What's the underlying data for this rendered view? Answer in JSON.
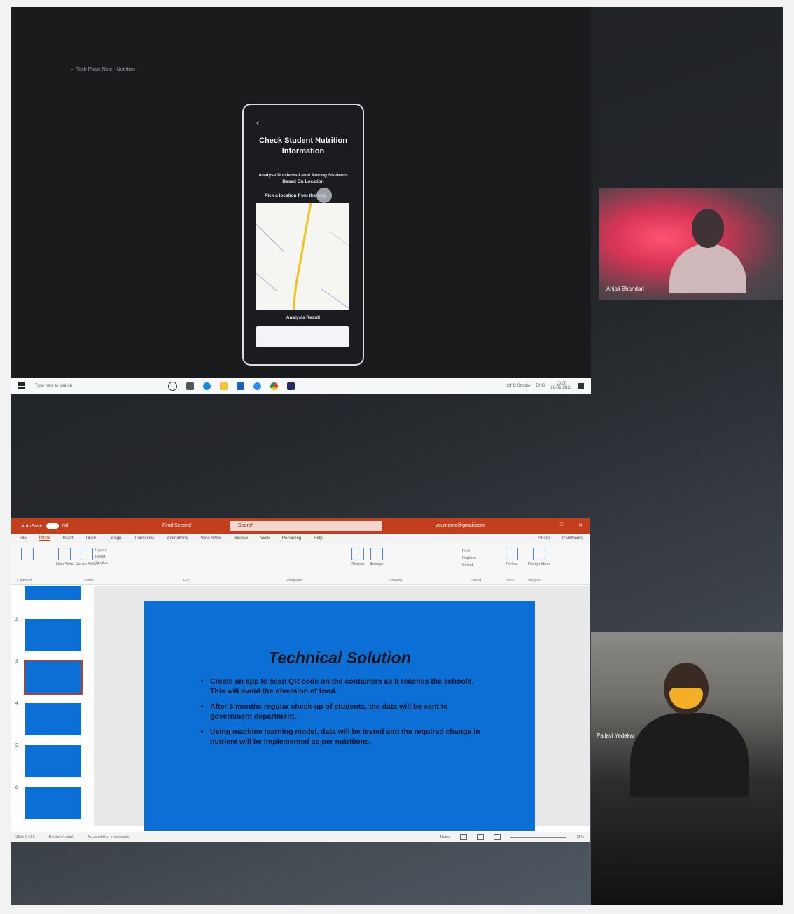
{
  "shared_screen": {
    "crumb": "← Tech Phate Note · Nutrition",
    "phone": {
      "back_glyph": "‹",
      "title": "Check Student Nutrition Information",
      "subtitle": "Analyse Nutrients Level Among Students Based On Location",
      "pick_label": "Pick a location from the map",
      "button_label": "Analysis Result"
    }
  },
  "taskbar": {
    "search_placeholder": "Type here to search",
    "tray_weather": "23°C Smoke",
    "tray_lang": "ENG",
    "tray_time": "10:00",
    "tray_date": "16-01-2021"
  },
  "participants": [
    {
      "name": "Anjali Bhandari"
    },
    {
      "name": "Pallavi Yedekar"
    }
  ],
  "powerpoint": {
    "autosave_label": "AutoSave",
    "toggle_state": "Off",
    "doc_name": "Final Second",
    "search_placeholder": "Search",
    "user": "yourname@gmail.com",
    "tabs": [
      "File",
      "Home",
      "Insert",
      "Draw",
      "Design",
      "Transitions",
      "Animations",
      "Slide Show",
      "Review",
      "View",
      "Recording",
      "Help"
    ],
    "active_tab": "Home",
    "share_label": "Share",
    "comments_label": "Comments",
    "ribbon": {
      "new_slide": "New Slide",
      "reuse_slides": "Reuse Slides",
      "layout": "Layout",
      "reset": "Reset",
      "section": "Section",
      "clipboard": "Clipboard",
      "slides_group": "Slides",
      "font_group": "Font",
      "paragraph_group": "Paragraph",
      "shapes": "Shapes",
      "arrange": "Arrange",
      "drawing_group": "Drawing",
      "find": "Find",
      "replace": "Replace",
      "select": "Select",
      "editing_group": "Editing",
      "dictate": "Dictate",
      "voice_group": "Voice",
      "design_ideas": "Design Ideas",
      "designer_group": "Designer"
    },
    "thumbnails": [
      "2",
      "3",
      "4",
      "5",
      "6"
    ],
    "slide": {
      "title": "Technical Solution",
      "bullets": [
        "Create an app to scan QR code on the containers as it reaches the schools. This will avoid the diversion of food.",
        "After 3 months regular check-up of students, the data will be sent to government department.",
        "Using machine learning model, data will be tested and the required change in nutrient will be implemented as per nutritions."
      ]
    },
    "status": {
      "slide_count": "Slide 3 of 6",
      "language": "English (India)",
      "accessibility": "Accessibility: Investigate",
      "notes": "Notes",
      "zoom": "72%"
    }
  },
  "colors": {
    "ppt_accent": "#c43e1c",
    "slide_bg": "#0b6fd6"
  }
}
